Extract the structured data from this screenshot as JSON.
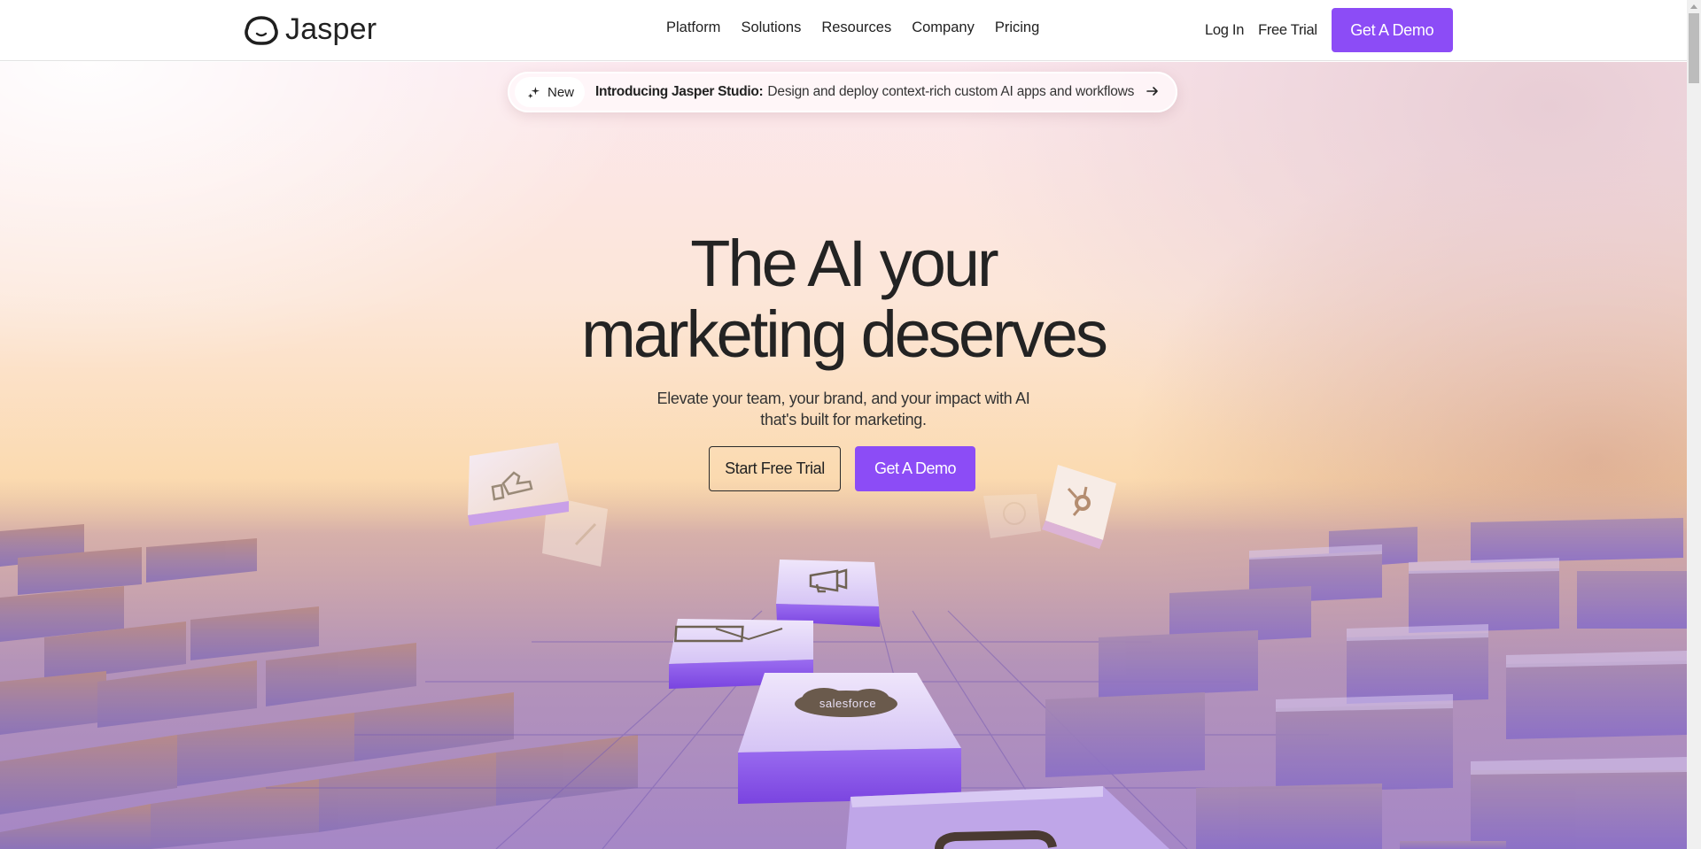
{
  "brand": {
    "name": "Jasper",
    "accent": "#8c4cf6"
  },
  "nav": {
    "items": [
      {
        "label": "Platform"
      },
      {
        "label": "Solutions"
      },
      {
        "label": "Resources"
      },
      {
        "label": "Company"
      },
      {
        "label": "Pricing"
      }
    ],
    "login_label": "Log In",
    "free_trial_label": "Free Trial",
    "demo_label": "Get A Demo"
  },
  "announcement": {
    "badge_icon": "sparkle-icon",
    "badge_label": "New",
    "title": "Introducing Jasper Studio:",
    "text": "Design and deploy context-rich custom AI apps and workflows",
    "arrow_icon": "arrow-right-icon"
  },
  "hero": {
    "headline_line1": "The AI your",
    "headline_line2": "marketing deserves",
    "subhead_line1": "Elevate your team, your brand, and your impact with AI",
    "subhead_line2": "that's built for marketing.",
    "primary_cta": "Start Free Trial",
    "secondary_cta": "Get A Demo"
  },
  "scene": {
    "tiles": [
      {
        "icon": "thumbs-up-icon"
      },
      {
        "icon": "pencil-icon"
      },
      {
        "icon": "pie-chart-icon"
      },
      {
        "icon": "hubspot-icon"
      },
      {
        "icon": "megaphone-icon"
      },
      {
        "icon": "mail-icon"
      },
      {
        "icon": "salesforce-icon",
        "label": "salesforce"
      },
      {
        "icon": "chat-icon"
      }
    ]
  }
}
